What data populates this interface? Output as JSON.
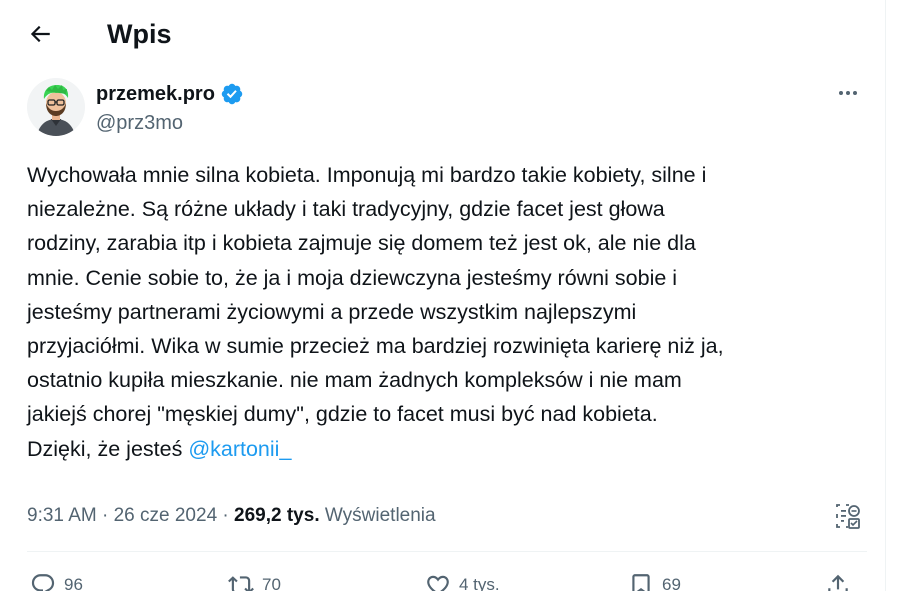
{
  "header": {
    "back_icon": "arrow-left-icon",
    "title": "Wpis"
  },
  "author": {
    "name": "przemek.pro",
    "handle": "@prz3mo",
    "verified_icon": "verified-badge-icon",
    "verified_color": "#1d9bf0",
    "avatar_icon": "avatar-green-hair-cartoon"
  },
  "more_icon": "more-dots-icon",
  "tweet": {
    "lines": [
      "Wychowała mnie silna kobieta. Imponują mi bardzo takie kobiety, silne i",
      "niezależne. Są różne układy i taki tradycyjny, gdzie facet jest głowa",
      "rodziny, zarabia itp i kobieta zajmuje się domem też jest ok, ale nie dla",
      "mnie. Cenie sobie to, że ja i moja dziewczyna jesteśmy równi sobie i",
      "jesteśmy partnerami życiowymi a przede wszystkim najlepszymi",
      "przyjaciółmi. Wika w sumie przecież ma bardziej rozwinięta karierę niż ja,",
      "ostatnio kupiła mieszkanie. nie mam żadnych kompleksów i nie mam",
      "jakiejś chorej \"męskiej dumy\", gdzie to facet musi być nad kobieta."
    ],
    "last_line_text": "Dzięki, że jesteś ",
    "mention": "@kartonii_",
    "mention_color": "#1d9bf0"
  },
  "meta": {
    "time": "9:31 AM",
    "separator": " · ",
    "date": "26 cze 2024",
    "separator2": " · ",
    "views_count": "269,2 tys.",
    "views_label": " Wyświetlenia",
    "analytics_icon": "analytics-icon"
  },
  "actions": {
    "reply": {
      "icon": "reply-icon",
      "count": "96"
    },
    "retweet": {
      "icon": "retweet-icon",
      "count": "70"
    },
    "like": {
      "icon": "heart-icon",
      "count": "4 tys."
    },
    "bookmark": {
      "icon": "bookmark-icon",
      "count": "69"
    },
    "share": {
      "icon": "share-icon"
    }
  }
}
